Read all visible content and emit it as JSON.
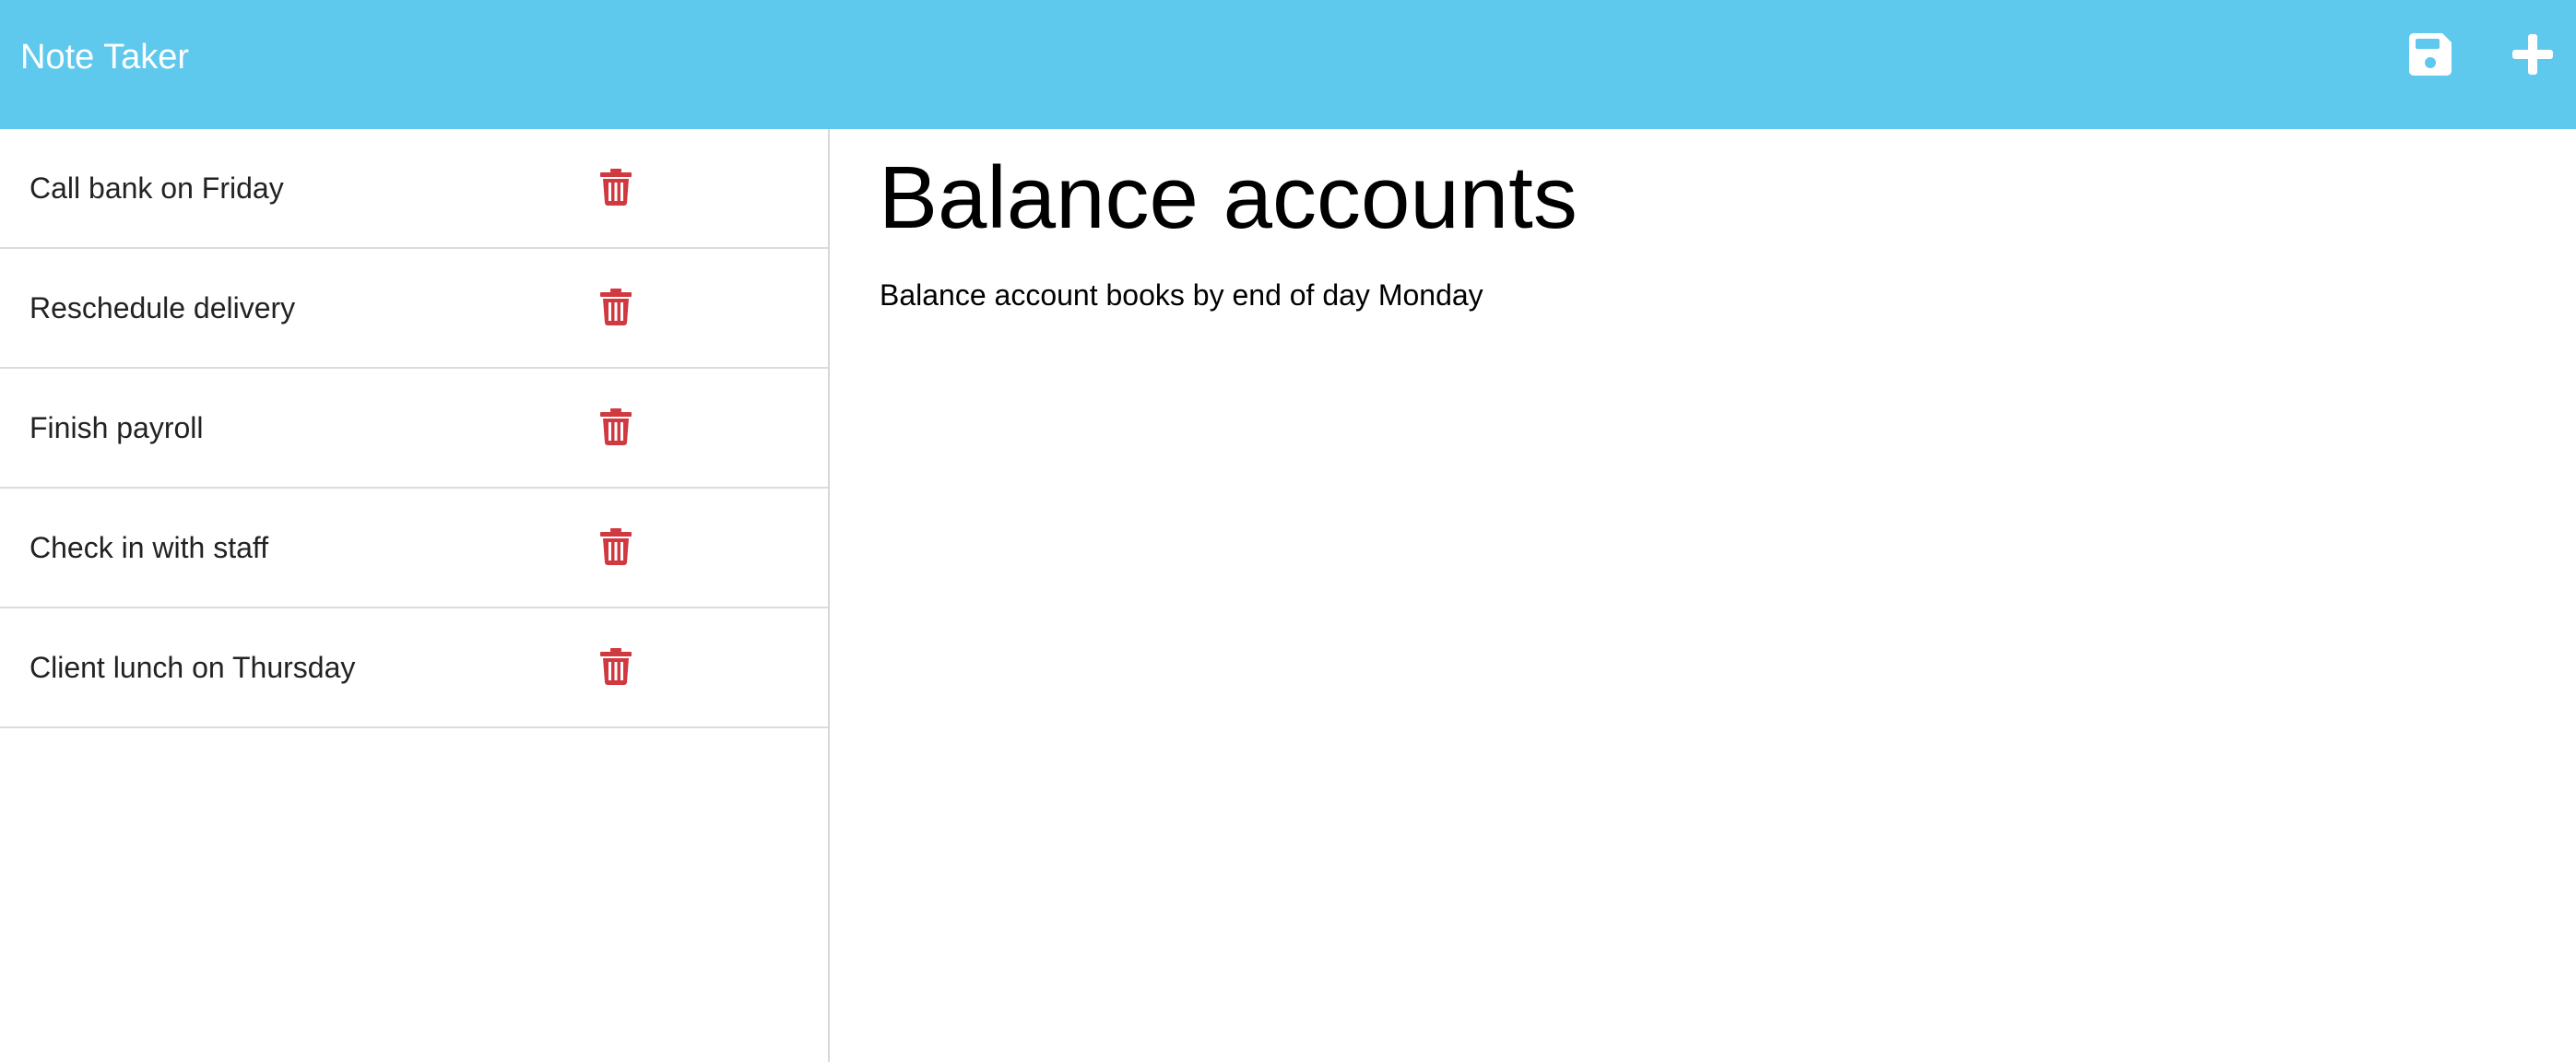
{
  "app": {
    "title": "Note Taker"
  },
  "toolbar": {
    "save_icon": "floppy-disk-icon",
    "new_icon": "plus-icon"
  },
  "notes": [
    {
      "title": "Call bank on Friday",
      "delete_icon": "trash-icon"
    },
    {
      "title": "Reschedule delivery",
      "delete_icon": "trash-icon"
    },
    {
      "title": "Finish payroll",
      "delete_icon": "trash-icon"
    },
    {
      "title": "Check in with staff",
      "delete_icon": "trash-icon"
    },
    {
      "title": "Client lunch on Thursday",
      "delete_icon": "trash-icon"
    }
  ],
  "active_note": {
    "title": "Balance accounts",
    "text": "Balance account books by end of day Monday"
  },
  "colors": {
    "navbar": "#5fc9ed",
    "delete_icon": "#d0393f",
    "nav_icon": "#ffffff"
  }
}
